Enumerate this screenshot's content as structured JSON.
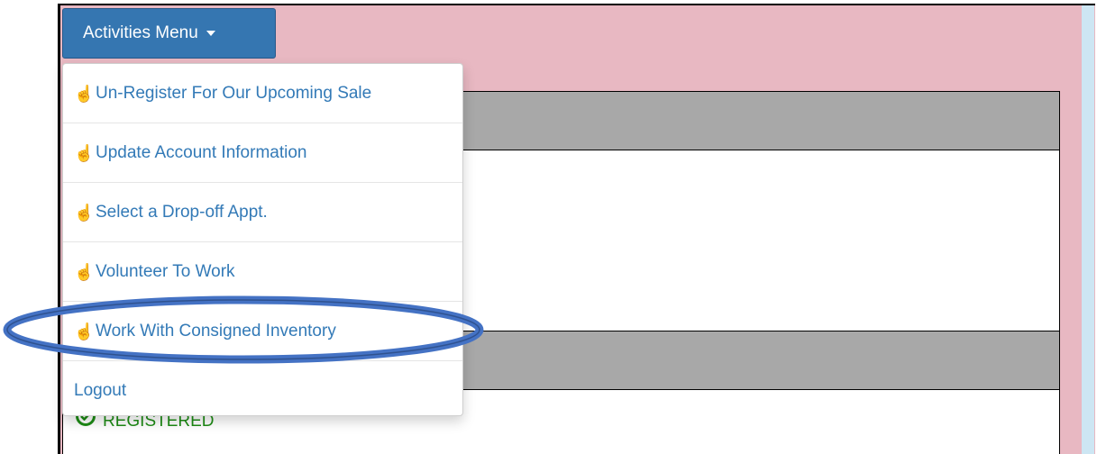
{
  "menu": {
    "button_label": "Activities Menu",
    "items": [
      {
        "label": "Un-Register For Our Upcoming Sale",
        "icon": "hand-pointer-icon"
      },
      {
        "label": "Update Account Information",
        "icon": "hand-pointer-icon"
      },
      {
        "label": "Select a Drop-off Appt.",
        "icon": "hand-pointer-icon"
      },
      {
        "label": "Volunteer To Work",
        "icon": "hand-pointer-icon"
      },
      {
        "label": "Work With Consigned Inventory",
        "icon": "hand-pointer-icon"
      }
    ],
    "logout_label": "Logout"
  },
  "status": {
    "text": "REGISTERED",
    "icon": "check-circle-icon",
    "color": "#1e8c16"
  },
  "colors": {
    "button": "#3576b1",
    "link": "#337ab7",
    "background": "#e8b8c2",
    "panel_header": "#a8a8a8",
    "highlight": "#4472c4"
  }
}
